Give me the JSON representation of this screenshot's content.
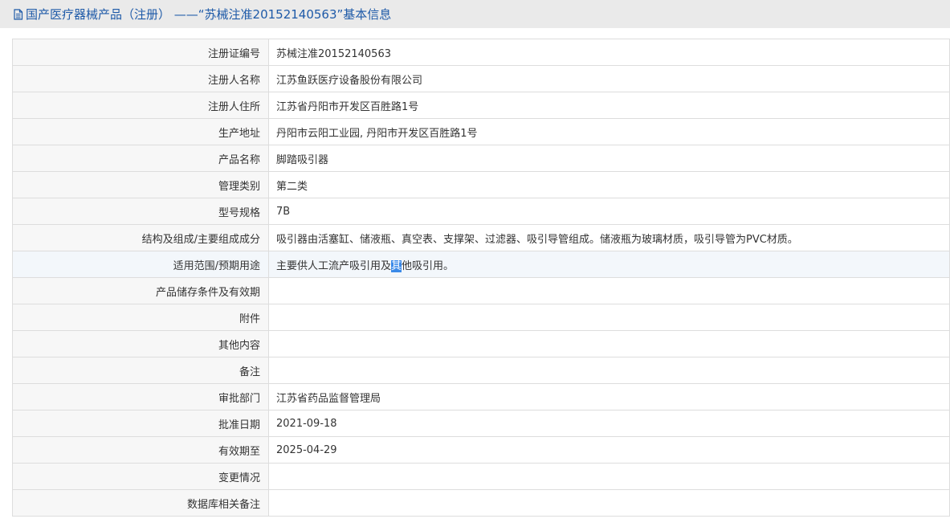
{
  "header": {
    "title": "国产医疗器械产品（注册） ——“苏械注准20152140563”基本信息",
    "icon": "document-icon",
    "color": "#1e5aa8"
  },
  "rows": [
    {
      "label": "注册证编号",
      "value": "苏械注准20152140563"
    },
    {
      "label": "注册人名称",
      "value": "江苏鱼跃医疗设备股份有限公司"
    },
    {
      "label": "注册人住所",
      "value": "江苏省丹阳市开发区百胜路1号"
    },
    {
      "label": "生产地址",
      "value": "丹阳市云阳工业园, 丹阳市开发区百胜路1号"
    },
    {
      "label": "产品名称",
      "value": "脚踏吸引器"
    },
    {
      "label": "管理类别",
      "value": "第二类"
    },
    {
      "label": "型号规格",
      "value": "7B"
    },
    {
      "label": "结构及组成/主要组成成分",
      "value": "吸引器由活塞缸、储液瓶、真空表、支撑架、过滤器、吸引导管组成。储液瓶为玻璃材质，吸引导管为PVC材质。"
    },
    {
      "label": "适用范围/预期用途",
      "value_pre": "主要供人工流产吸引用及",
      "value_sel": "其",
      "value_post": "他吸引用。"
    },
    {
      "label": "产品储存条件及有效期",
      "value": ""
    },
    {
      "label": "附件",
      "value": ""
    },
    {
      "label": "其他内容",
      "value": ""
    },
    {
      "label": "备注",
      "value": ""
    },
    {
      "label": "审批部门",
      "value": "江苏省药品监督管理局"
    },
    {
      "label": "批准日期",
      "value": "2021-09-18"
    },
    {
      "label": "有效期至",
      "value": "2025-04-29"
    },
    {
      "label": "变更情况",
      "value": ""
    },
    {
      "label": "数据库相关备注",
      "value": ""
    }
  ]
}
